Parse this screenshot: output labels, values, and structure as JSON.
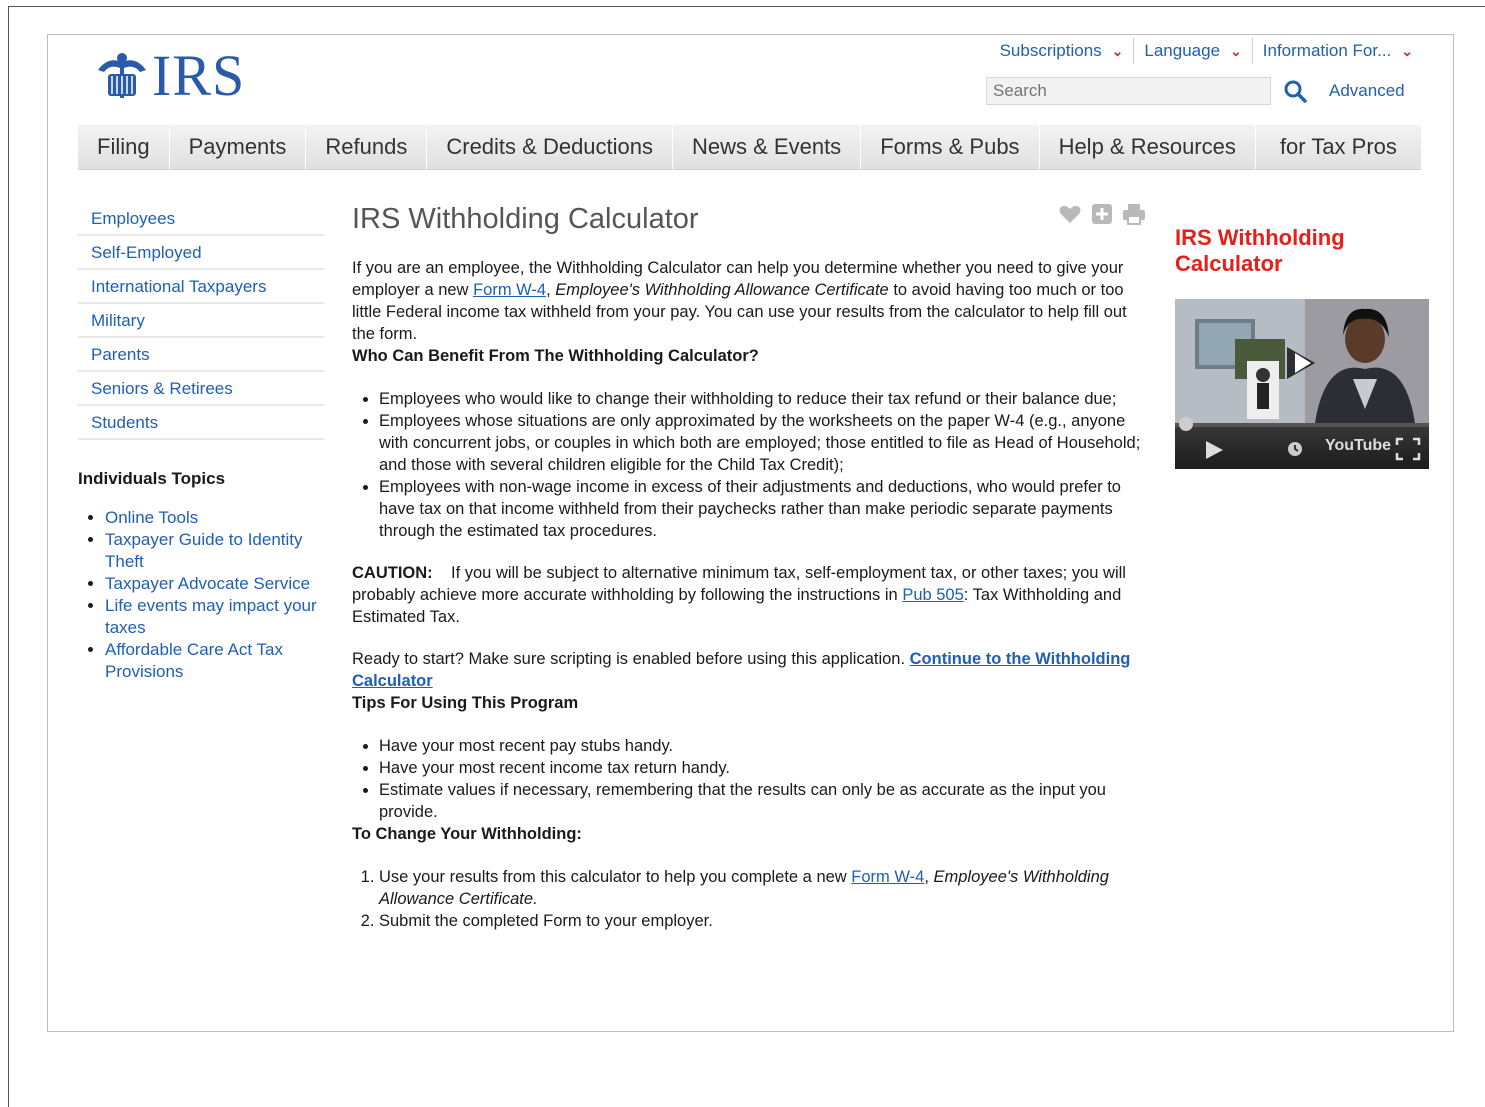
{
  "header": {
    "logo_text": "IRS",
    "utility": [
      {
        "label": "Subscriptions"
      },
      {
        "label": "Language"
      },
      {
        "label": "Information For..."
      }
    ],
    "search": {
      "placeholder": "Search"
    },
    "advanced_label": "Advanced"
  },
  "nav": [
    "Filing",
    "Payments",
    "Refunds",
    "Credits & Deductions",
    "News & Events",
    "Forms & Pubs",
    "Help & Resources",
    "for Tax Pros"
  ],
  "sidebar": {
    "links": [
      "Employees",
      "Self-Employed",
      "International Taxpayers",
      "Military",
      "Parents",
      "Seniors & Retirees",
      "Students"
    ],
    "topics_title": "Individuals Topics",
    "topics": [
      "Online Tools",
      "Taxpayer Guide to Identity Theft",
      "Taxpayer Advocate Service",
      "Life events may impact your taxes",
      "Affordable Care Act Tax Provisions"
    ]
  },
  "main": {
    "title": "IRS Withholding Calculator",
    "intro": {
      "t1": "If you are an employee, the Withholding Calculator can help you determine whether you need to give your employer a new ",
      "link1": "Form W-4",
      "t2": ", ",
      "italic1": "Employee's Withholding Allowance Certificate",
      "t3": " to avoid having too much or too little Federal income tax withheld from your pay. You can use your results from the calculator to help fill out the form."
    },
    "who_heading": "Who Can Benefit From The Withholding Calculator?",
    "who_items": [
      "Employees who would like to change their withholding to reduce their tax refund or their balance due;",
      "Employees whose situations are only approximated by the worksheets on the paper W-4 (e.g., anyone with concurrent jobs, or couples in which both are employed; those entitled to file as Head of Household; and those with several children eligible for the Child Tax Credit);",
      "Employees with non-wage income in excess of their adjustments and deductions, who would prefer to have tax on that income withheld from their paychecks rather than make periodic separate payments through the estimated tax procedures."
    ],
    "caution": {
      "label": "CAUTION:",
      "t1": "If you will be subject to alternative minimum tax, self-employment tax, or other taxes; you will probably achieve more accurate withholding by following the instructions in ",
      "link": "Pub 505",
      "t2": ": Tax Withholding and Estimated Tax."
    },
    "ready": {
      "t1": "Ready to start? Make sure scripting is enabled before using this application. ",
      "link": "Continue to the Withholding Calculator"
    },
    "tips_heading": "Tips For Using This Program",
    "tips_items": [
      "Have your most recent pay stubs handy.",
      "Have your most recent income tax return handy.",
      "Estimate values if necessary, remembering that the results can only be as accurate as the input you provide."
    ],
    "change_heading": "To Change Your Withholding:",
    "change_items": {
      "i1_t1": "Use your results from this calculator to help you complete a new ",
      "i1_link": "Form W-4",
      "i1_t2": ", ",
      "i1_italic": "Employee's Withholding Allowance Certificate.",
      "i2": "Submit the completed Form to your employer."
    }
  },
  "right": {
    "title": "IRS Withholding Calculator",
    "video_brand": "YouTube"
  },
  "colors": {
    "link": "#1f5fb5",
    "accent_red": "#e32119",
    "logo_blue": "#2a5aa8"
  }
}
